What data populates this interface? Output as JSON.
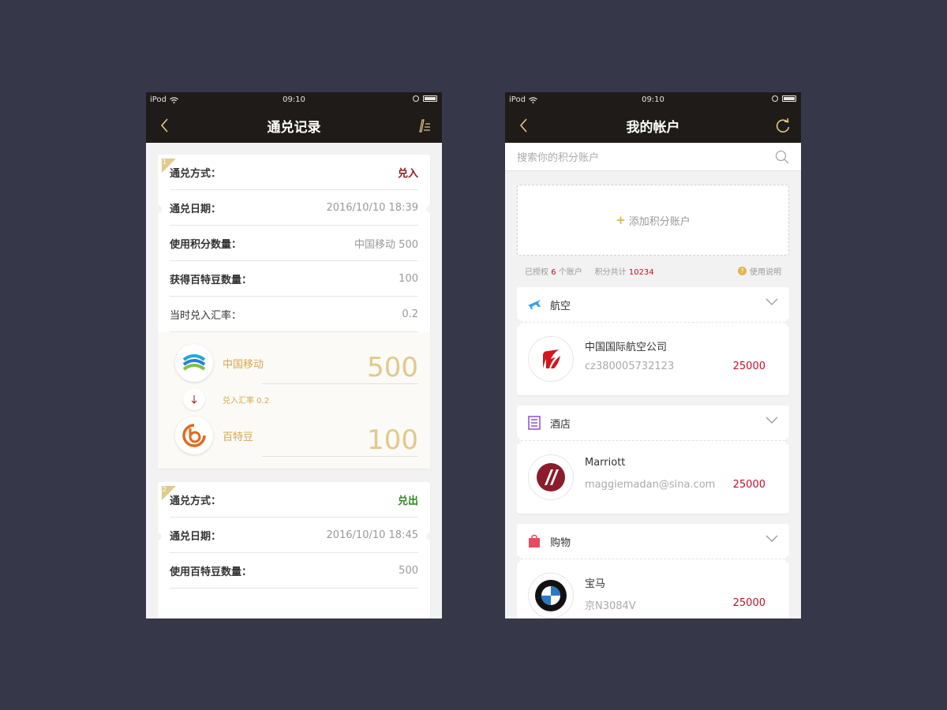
{
  "left_screen": {
    "status": {
      "carrier": "iPod",
      "time": "09:10"
    },
    "nav": {
      "title": "通兑记录"
    },
    "records": [
      {
        "index": "1",
        "rows": [
          {
            "key": "通兑方式：",
            "value": "兑入",
            "style": "in"
          },
          {
            "key": "通兑日期：",
            "value": "2016/10/10  18:39"
          },
          {
            "key": "使用积分数量：",
            "value": "中国移动   500"
          },
          {
            "key": "获得百特豆数量：",
            "value": "100"
          },
          {
            "key": "当时兑入汇率：",
            "value": "0.2"
          }
        ],
        "exchange": {
          "from_name": "中国移动",
          "from_value": "500",
          "rate_label": "兑入汇率  0.2",
          "to_name": "百特豆",
          "to_value": "100"
        }
      },
      {
        "index": "2",
        "rows": [
          {
            "key": "通兑方式：",
            "value": "兑出",
            "style": "out"
          },
          {
            "key": "通兑日期：",
            "value": "2016/10/10  18:45"
          },
          {
            "key": "使用百特豆数量：",
            "value": "500"
          }
        ]
      }
    ]
  },
  "right_screen": {
    "status": {
      "carrier": "iPod",
      "time": "09:10"
    },
    "nav": {
      "title": "我的帐户"
    },
    "search": {
      "placeholder": "搜索你的积分账户"
    },
    "add_account": {
      "label": "添加积分账户"
    },
    "summary": {
      "authorized_prefix": "已授权",
      "authorized_count": "6",
      "authorized_suffix": "个账户",
      "total_label": "积分共计",
      "total_value": "10234",
      "help_label": "使用说明"
    },
    "categories": [
      {
        "name": "航空",
        "icon": "plane-icon",
        "color": "#3aa0e8",
        "account": {
          "name": "中国国际航空公司",
          "id": "cz380005732123",
          "points": "25000",
          "logo": "air-china-logo"
        }
      },
      {
        "name": "酒店",
        "icon": "hotel-icon",
        "color": "#8a4fd0",
        "account": {
          "name": "Marriott",
          "id": "maggiemadan@sina.com",
          "points": "25000",
          "logo": "marriott-logo"
        }
      },
      {
        "name": "购物",
        "icon": "shopping-bag-icon",
        "color": "#e84a5f",
        "account": {
          "name": "宝马",
          "id": "京N3084V",
          "points": "25000",
          "logo": "bmw-logo"
        }
      }
    ]
  },
  "colors": {
    "background": "#37374a",
    "navbar": "#1e1b18",
    "gold": "#e1c98a",
    "red": "#c0102a"
  }
}
